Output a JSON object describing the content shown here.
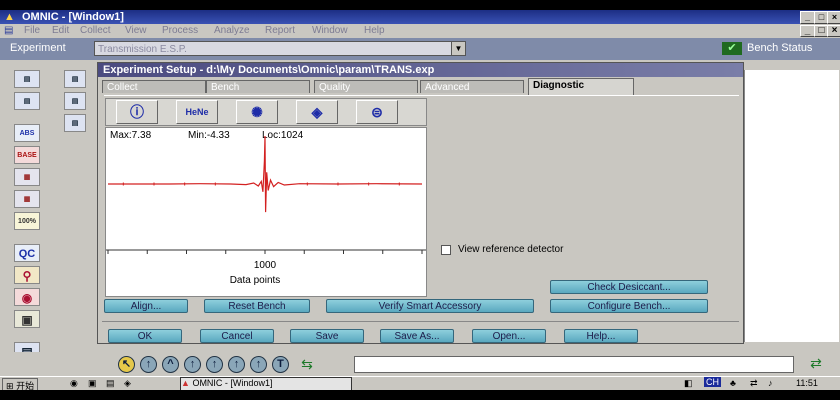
{
  "app": {
    "title": "OMNIC - [Window1]"
  },
  "menu": [
    "File",
    "Edit",
    "Collect",
    "View",
    "Process",
    "Analyze",
    "Report",
    "Window",
    "Help"
  ],
  "experiment": {
    "label": "Experiment",
    "value": "Transmission E.S.P.",
    "bench_status": "Bench Status"
  },
  "left_toolbar": [
    {
      "name": "collect-sample-icon",
      "text": ""
    },
    {
      "name": "collect-background-icon",
      "text": ""
    },
    {
      "name": "abs-icon",
      "text": "ABS"
    },
    {
      "name": "baseline-icon",
      "text": "BASE"
    },
    {
      "name": "automatic-baseline-icon",
      "text": ""
    },
    {
      "name": "autoscale-icon",
      "text": ""
    },
    {
      "name": "find-peaks-icon",
      "text": "100%"
    },
    {
      "name": "qc-icon",
      "text": "QC"
    },
    {
      "name": "search-icon",
      "text": ""
    },
    {
      "name": "library-icon",
      "text": ""
    },
    {
      "name": "report-icon",
      "text": ""
    },
    {
      "name": "print-icon",
      "text": ""
    }
  ],
  "dialog": {
    "title": "Experiment Setup - d:\\My Documents\\Omnic\\param\\TRANS.exp",
    "tabs": [
      "Collect",
      "Bench",
      "Quality",
      "Advanced",
      "Diagnostic"
    ],
    "active_tab": "Diagnostic",
    "diag_icons": [
      {
        "name": "power-icon",
        "glyph": "ⓘ"
      },
      {
        "name": "hene-laser-icon",
        "glyph": "HeNe"
      },
      {
        "name": "source-lamp-icon",
        "glyph": "✺"
      },
      {
        "name": "desiccant-icon",
        "glyph": "◈"
      },
      {
        "name": "detector-icon",
        "glyph": "⊜"
      }
    ],
    "stats": {
      "max": "Max:7.38",
      "min": "Min:-4.33",
      "loc": "Loc:1024"
    },
    "view_reference_label": "View reference detector",
    "buttons": {
      "align": "Align...",
      "reset_bench": "Reset Bench",
      "verify": "Verify Smart Accessory",
      "check_desiccant": "Check Desiccant...",
      "configure_bench": "Configure Bench...",
      "ok": "OK",
      "cancel": "Cancel",
      "save": "Save",
      "save_as": "Save As...",
      "open": "Open...",
      "help": "Help..."
    }
  },
  "chart_data": {
    "type": "line",
    "xlabel": "Data points",
    "x_ticks": [
      "1000"
    ],
    "series": [
      {
        "color": "#d32020",
        "x": [
          0,
          200,
          400,
          600,
          800,
          900,
          950,
          980,
          1000,
          1010,
          1020,
          1024,
          1028,
          1035,
          1045,
          1060,
          1080,
          1110,
          1150,
          1250,
          1500,
          1750,
          2048
        ],
        "y": [
          0,
          0,
          0,
          0.05,
          0,
          -0.1,
          0.15,
          -0.3,
          0.4,
          -1.2,
          3.5,
          7.38,
          -4.33,
          1.8,
          -1.0,
          0.6,
          -0.4,
          0.25,
          -0.15,
          0.05,
          0,
          0.05,
          0
        ]
      }
    ],
    "stats": {
      "max": 7.38,
      "min": -4.33,
      "loc": 1024
    }
  },
  "status": {
    "time": "11:51",
    "taskbar_item": "OMNIC - [Window1]",
    "start": "开始"
  },
  "colors": {
    "title_bar": "#1c2e84",
    "button": "#6db8cc",
    "plot_line": "#d32020"
  }
}
